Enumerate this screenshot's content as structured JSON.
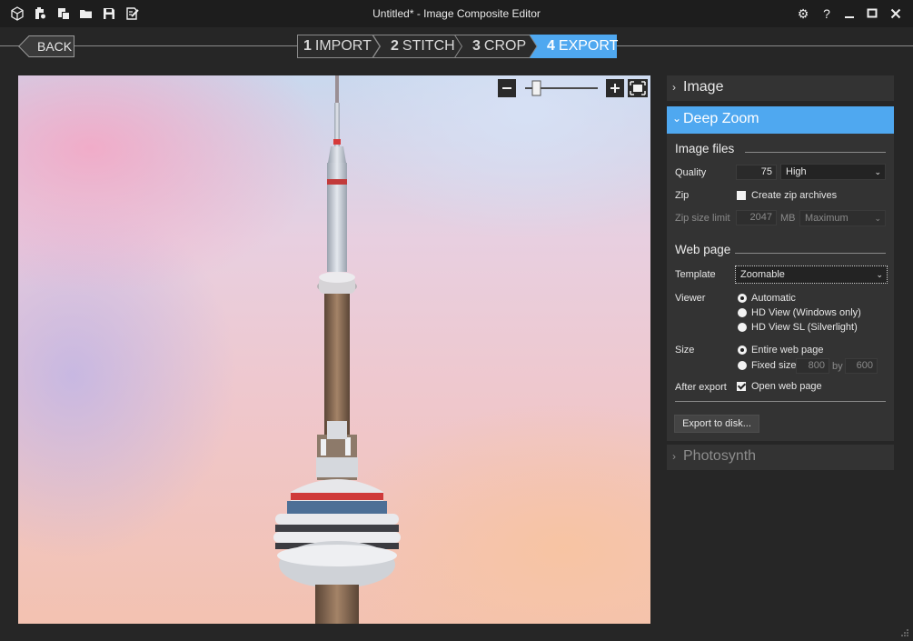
{
  "window": {
    "title": "Untitled* - Image Composite Editor"
  },
  "toolbar_icons": [
    "new-panorama-icon",
    "new-from-video-icon",
    "new-stitch-icon",
    "open-icon",
    "save-icon",
    "save-as-icon"
  ],
  "window_controls": {
    "settings": "⚙",
    "help": "?",
    "minimize": "‒",
    "maximize": "▢",
    "close": "✕"
  },
  "nav": {
    "back_label": "BACK",
    "steps": [
      {
        "num": "1",
        "label": "IMPORT"
      },
      {
        "num": "2",
        "label": "STITCH"
      },
      {
        "num": "3",
        "label": "CROP"
      },
      {
        "num": "4",
        "label": "EXPORT"
      }
    ],
    "active_step": 4
  },
  "zoom": {
    "level": 0.1
  },
  "panel": {
    "image_section": "Image",
    "deep_zoom_section": "Deep Zoom",
    "photosynth_section": "Photosynth",
    "image_files": {
      "title": "Image files",
      "quality_label": "Quality",
      "quality_value": "75",
      "quality_preset": "High",
      "zip_label": "Zip",
      "zip_checkbox_label": "Create zip archives",
      "zip_checked": false,
      "zip_size_label": "Zip size limit",
      "zip_size_value": "2047",
      "zip_size_unit": "MB",
      "zip_size_preset": "Maximum"
    },
    "web_page": {
      "title": "Web page",
      "template_label": "Template",
      "template_value": "Zoomable",
      "viewer_label": "Viewer",
      "viewer_options": [
        "Automatic",
        "HD View (Windows only)",
        "HD View SL (Silverlight)"
      ],
      "viewer_selected": 0,
      "size_label": "Size",
      "size_options": [
        "Entire web page",
        "Fixed size:"
      ],
      "size_selected": 0,
      "width_value": "800",
      "by_label": "by",
      "height_value": "600",
      "after_export_label": "After export",
      "open_web_page_label": "Open web page",
      "open_web_page_checked": true
    },
    "export_button": "Export to disk..."
  },
  "colors": {
    "accent": "#4fa8f0",
    "panel_bg": "#333333",
    "app_bg": "#262626"
  }
}
